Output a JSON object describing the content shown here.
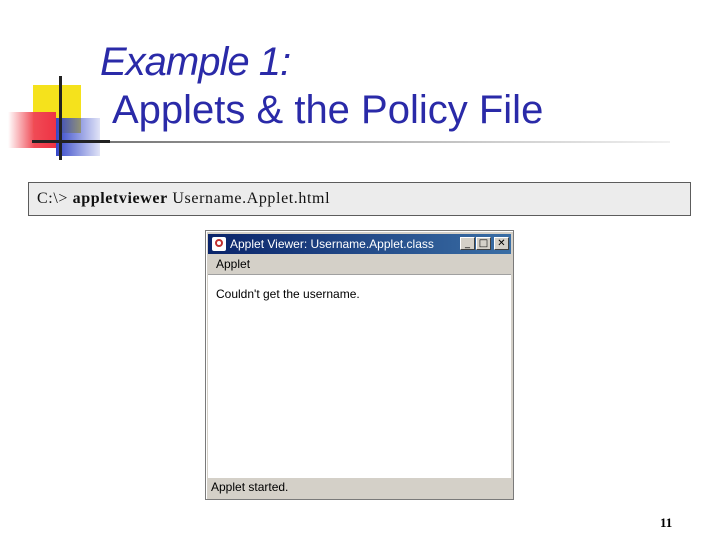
{
  "slide": {
    "title_line1": "Example 1:",
    "title_line2": "Applets & the Policy File",
    "page_number": "11"
  },
  "command": {
    "prompt": "C:\\>",
    "program": "appletviewer",
    "argument": "Username.Applet.html"
  },
  "applet_window": {
    "title": "Applet Viewer: Username.Applet.class",
    "icon": "java-icon",
    "buttons": {
      "minimize": "_",
      "maximize": "□",
      "close": "✕"
    },
    "menu": [
      "Applet"
    ],
    "message": "Couldn't get the username.",
    "status": "Applet started."
  },
  "colors": {
    "title_blue": "#2a2aa8",
    "titlebar_start": "#0a246a",
    "titlebar_end": "#3a6ea5",
    "window_gray": "#d4d0c8"
  }
}
